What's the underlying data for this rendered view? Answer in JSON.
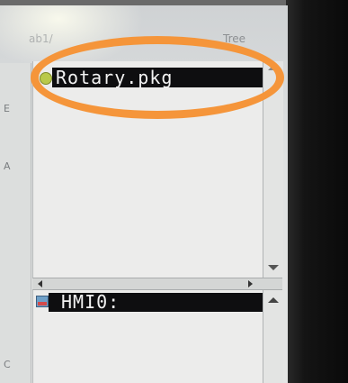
{
  "header": {
    "left_label": "ab1/",
    "tree_label": "Tree"
  },
  "left_strip": {
    "marks": [
      "E",
      "A",
      "C"
    ]
  },
  "file_list": {
    "selected_item": "Rotary.pkg",
    "item_icon": "package-icon"
  },
  "tree_list": {
    "selected_item": "HMI0:",
    "item_icon": "drive-icon"
  },
  "annotation": {
    "color": "#f5953a",
    "shape": "ellipse"
  }
}
